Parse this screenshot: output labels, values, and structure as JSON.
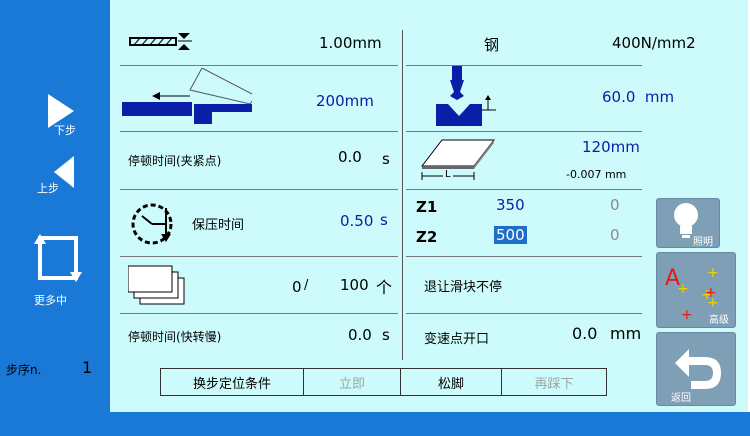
{
  "sidebar": {
    "next_label": "下步",
    "prev_label": "上步",
    "more_label": "更多中",
    "step_label": "步序n.",
    "step_value": "1"
  },
  "cells": {
    "thickness_value": "1.00mm",
    "material_name": "钢",
    "material_strength": "400N/mm2",
    "flange_value": "200mm",
    "die_opening_value": "60.0  mm",
    "dwell_clamp_label": "停顿时间(夹紧点)",
    "dwell_clamp_value": "0.0",
    "dwell_clamp_unit": "s",
    "length_value": "120mm",
    "length_sub_value": "-0.007 mm",
    "length_icon_letter": "L",
    "hold_label": "保压时间",
    "hold_value": "0.50",
    "hold_unit": "s",
    "z1_label": "Z1",
    "z1_value": "350",
    "z1_actual": "0",
    "z2_label": "Z2",
    "z2_value": "500",
    "z2_actual": "0",
    "count_done": "0",
    "count_sep": "/",
    "count_total": "100",
    "count_unit": "个",
    "retract_label": "退让滑块不停",
    "dwell_fast_label": "停顿时间(快转慢)",
    "dwell_fast_value": "0.0",
    "dwell_fast_unit": "s",
    "speed_change_label": "变速点开口",
    "speed_change_value": "0.0",
    "speed_change_unit": "mm"
  },
  "right_buttons": {
    "light_label": "照明",
    "advanced_label": "高级",
    "back_label": "返回"
  },
  "tabs": [
    {
      "label": "换步定位条件",
      "enabled": true
    },
    {
      "label": "立即",
      "enabled": false
    },
    {
      "label": "松脚",
      "enabled": true
    },
    {
      "label": "再踩下",
      "enabled": false
    }
  ],
  "colors": {
    "sidebar_blue": "#1a79d6",
    "panel_cyan": "#cdfbfb",
    "value_blue": "#0a1ea8",
    "button_grey": "#7f9fb6",
    "highlight_blue": "#1f6fc9"
  }
}
